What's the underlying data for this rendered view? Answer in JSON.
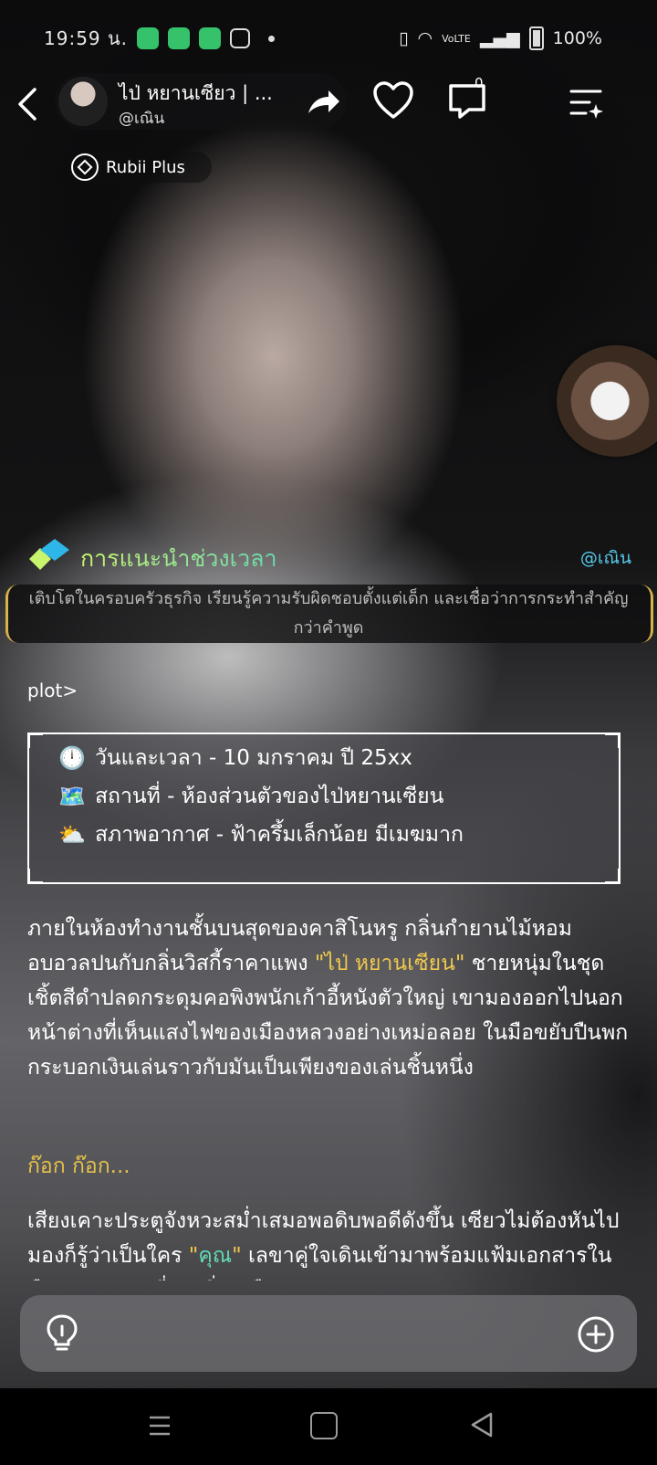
{
  "status_bar": {
    "time": "19:59 น.",
    "battery": "100%",
    "network": "VoLTE"
  },
  "header": {
    "title": "ไป่ หยานเซียว | ...",
    "handle": "@เณิน",
    "comment_count": "0",
    "badge": "Rubii Plus"
  },
  "intro": {
    "title": "การแนะนำช่วงเวลา",
    "handle": "@เณิน",
    "text": "เติบโตในครอบครัวธุรกิจ เรียนรู้ความรับผิดชอบตั้งแต่เด็ก และเชื่อว่าการกระทำสำคัญกว่าคำพูด"
  },
  "story": {
    "plot_label": "plot>",
    "info": [
      {
        "icon": "clock-icon",
        "emoji": "🕛",
        "text": "วันและเวลา - 10 มกราคม ปี 25xx"
      },
      {
        "icon": "map-icon",
        "emoji": "🗺️",
        "text": "สถานที่ - ห้องส่วนตัวของไป่หยานเซียน"
      },
      {
        "icon": "weather-icon",
        "emoji": "⛅",
        "text": "สภาพอากาศ - ฟ้าครึ้มเล็กน้อย มีเมฆมาก"
      }
    ],
    "p1_a": "ภายในห้องทำงานชั้นบนสุดของคาสิโนหรู กลิ่นกำยานไม้หอมอบอวลปนกับกลิ่นวิสกี้ราคาแพง ",
    "p1_name": "\"ไป่ หยานเซียน\"",
    "p1_b": " ชายหนุ่มในชุดเชิ้ตสีดำปลดกระดุมคอพิงพนักเก้าอี้หนังตัวใหญ่ เขามองออกไปนอกหน้าต่างที่เห็นแสงไฟของเมืองหลวงอย่างเหม่อลอย ในมือขยับปืนพกกระบอกเงินเล่นราวกับมันเป็นเพียงของเล่นชิ้นหนึ่ง",
    "p2": "ก๊อก ก๊อก...",
    "p3_a": "เสียงเคาะประตูจังหวะสม่ำเสมอพอดิบพอดีดังขึ้น เซียวไม่ต้องหันไปมองก็รู้ว่าเป็นใคร ",
    "p3_name": "\"คุณ\"",
    "p3_b": " เลขาคู่ใจเดินเข้ามาพร้อมแฟ้มเอกสารในมือและท่าทางที่สงบนิ่งเหมือนเช่นเคย"
  },
  "colors": {
    "accent_yellow": "#f0c94c",
    "accent_teal": "#62d9b5",
    "handle_blue": "#58c8e8"
  }
}
